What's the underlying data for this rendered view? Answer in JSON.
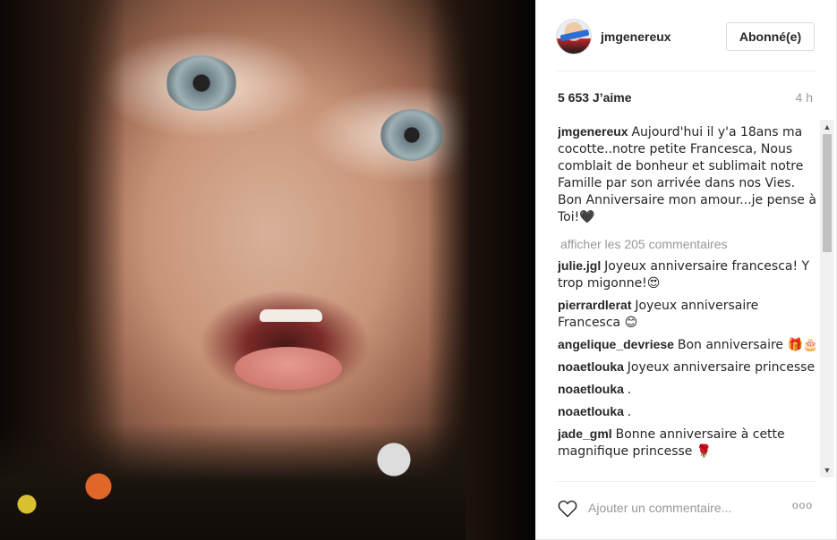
{
  "header": {
    "username": "jmgenereux",
    "follow_label": "Abonné(e)"
  },
  "stats": {
    "likes": "5 653 J’aime",
    "time": "4 h"
  },
  "caption": {
    "user": "jmgenereux",
    "text": "Aujourd'hui il y'a 18ans ma cocotte..notre petite Francesca, Nous comblait de bonheur et sublimait notre Famille par son arrivée dans nos Vies. Bon Anniversaire mon amour...je pense à Toi!🖤"
  },
  "load_more": "afficher les 205 commentaires",
  "comments": [
    {
      "user": "julie.jgl",
      "text": "Joyeux anniversaire francesca! Y trop migonne!😍"
    },
    {
      "user": "pierrardlerat",
      "text": "Joyeux anniversaire Francesca 😊"
    },
    {
      "user": "angelique_devriese",
      "text": "Bon anniversaire 🎁🎂"
    },
    {
      "user": "noaetlouka",
      "text": "Joyeux anniversaire princesse"
    },
    {
      "user": "noaetlouka",
      "text": "."
    },
    {
      "user": "noaetlouka",
      "text": "."
    },
    {
      "user": "jade_gml",
      "text": "Bonne anniversaire à cette magnifique princesse 🌹"
    }
  ],
  "footer": {
    "comment_placeholder": "Ajouter un commentaire...",
    "more_label": "ooo"
  },
  "icons": {
    "heart": "heart-outline-icon",
    "scroll_up": "chevron-up-icon",
    "scroll_down": "chevron-down-icon"
  }
}
